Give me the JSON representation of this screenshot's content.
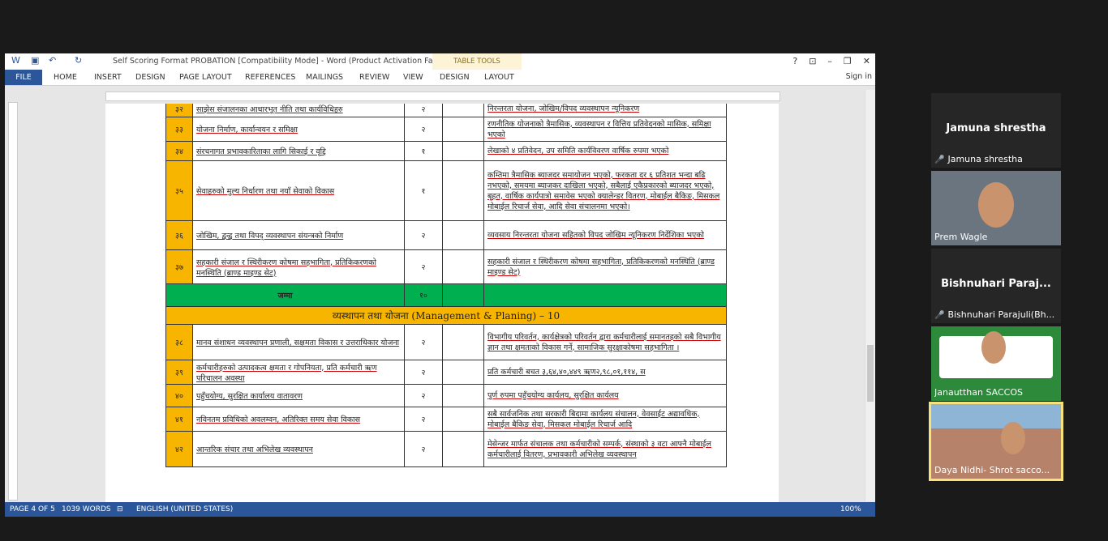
{
  "word": {
    "title": "Self Scoring Format PROBATION [Compatibility Mode] - Word (Product Activation Failed)",
    "table_tools": "TABLE TOOLS",
    "tabs": [
      "FILE",
      "HOME",
      "INSERT",
      "DESIGN",
      "PAGE LAYOUT",
      "REFERENCES",
      "MAILINGS",
      "REVIEW",
      "VIEW",
      "DESIGN",
      "LAYOUT"
    ],
    "sign_in": "Sign in",
    "status": {
      "page": "PAGE 4 OF 5",
      "words": "1039 WORDS",
      "lang": "ENGLISH (UNITED STATES)",
      "zoom": "100%"
    }
  },
  "table": {
    "rows": [
      {
        "num": "३२",
        "name": "साझेस संजालनका आधारभूत नीति तथा कार्यविधिहरु",
        "score": "२",
        "note": "निरन्तरता योजना, जोखिम/विपद व्यवस्थापन न्यूनिकरण"
      },
      {
        "num": "३३",
        "name": "योजना निर्माण, कार्यान्वयन र समिक्षा",
        "score": "२",
        "note": "रणनीतिक योजनाको त्रैमासिक, व्यवस्थापन र वित्तिय प्रतिवेदनको मासिक, समिक्षा भएको"
      },
      {
        "num": "३४",
        "name": "संरचनागत प्रभावकारिताका लागि सिकाई र वृद्दि",
        "score": "१",
        "note": "लेखाको ४ प्रतिवेदन, उप समिति कार्यविवरण वार्षिक रुपमा भएको"
      },
      {
        "num": "३५",
        "name": "सेवाहरुको मुल्य निर्धारण तथा नयाँ सेवाको विकास",
        "score": "१",
        "note": "कम्तिमा त्रैमासिक ब्याजदर समायोजन भएको, फरकता दर ६ प्रतिशत भन्दा बढि नभएको, समयमा ब्याजकर दाखिला भएको, सबैलाई एकैप्रकारको ब्याजदर भएको, बृहत, वार्षिक कार्यपात्रो समावेस भएको क्यालेन्डर वितरण, मोबाईल बैकिङ, मिसकल मोबाईल रिचार्ज सेवा, आदि सेवा संचालनमा भएको।"
      },
      {
        "num": "३६",
        "name": "जोखिम, द्वन्द्व तथा विपद् व्यवस्थापन संयन्त्रको निर्माण",
        "score": "२",
        "note": "व्यवसाय निरन्तरता योजना सहितको विपद जोखिम न्यूनिकरण निर्देशिका भएको"
      },
      {
        "num": "३७",
        "name": "सहकारी संजाल र स्थिरीकरण कोषमा सहभागिता, प्रतिकिकरणको मनस्थिति (ब्राण्ड माइण्ड सेट)",
        "score": "२",
        "note": "सहकारी संजाल र स्थिरीकरण कोषमा सहभागिता, प्रतिकिकरणको मनस्थिति (ब्राण्ड माइण्ड सेट)"
      }
    ],
    "total_label": "जम्मा",
    "total_value": "१०",
    "section_heading": "व्यस्थापन तथा योजना (Management & Planing) – 10",
    "rows2": [
      {
        "num": "३८",
        "name": "मानव संशाधन व्यवस्थापन प्रणाली, सक्षमता विकास र उत्तराधिकार योजना",
        "score": "२",
        "note": "विभागीय परिवर्तन, कार्यक्षेत्रको परिवर्तन द्वारा कर्मचारीलाई समानतहको सबै विभागीय  ज्ञान तथा क्षमताको विकास गर्ने, सामाजिक सुरक्षाकोषमा सहभागिता ।"
      },
      {
        "num": "३९",
        "name": "कर्मचारीहरुको उत्पादकत्व क्षमता र गोपनियता, प्रति कर्मचारी ऋण परिचालन अवस्था",
        "score": "२",
        "note": "प्रति कर्मचारी बचत ३,६४,४०,४४९ ऋण२,९८,०१,११४, स"
      },
      {
        "num": "४०",
        "name": "पहुँचयोग्य, सुरक्षित कार्यालय वातावरण",
        "score": "२",
        "note": "पूर्ण रुपमा पहुँचयोग्य कार्यलय, सुरक्षित कार्यलय"
      },
      {
        "num": "४१",
        "name": "नविनतम प्रविधिको अवलम्वन, अतिरिक्त समय सेवा विकास",
        "score": "२",
        "note": "सबै सार्वजनिक तथा सरकारी बिदामा कार्यलय संचालन, वेवसाईट अद्यावधिक, मोबाईल बैकिङ सेवा, मिसकल मोबाईल रिचार्ज आदि"
      },
      {
        "num": "४२",
        "name": "आन्तरिक संचार तथा अभिलेख व्यवस्थापन",
        "score": "२",
        "note": "मेसेन्जर मार्फत संचालक तथा कर्मचारीको सम्पर्क, संस्थाको ३ वटा आफ्नै मोबाईल कर्मचारीलाई वितरण, प्रभावकारी अभिलेख व्यवस्थापन"
      }
    ]
  },
  "participants": [
    {
      "big": "Jamuna shrestha",
      "label": "Jamuna shrestha",
      "muted": true
    },
    {
      "big": "",
      "label": "Prem Wagle",
      "muted": false
    },
    {
      "big": "Bishnuhari  Paraj...",
      "label": "Bishnuhari Parajuli(Bh...",
      "muted": true
    },
    {
      "big": "",
      "label": "Janautthan SACCOS",
      "muted": false
    },
    {
      "big": "",
      "label": "Daya Nidhi- Shrot sacco...",
      "muted": false
    }
  ],
  "colors": {
    "accent": "#2b579a",
    "table_orange": "#f7b500",
    "table_green": "#00b050",
    "active_speaker": "#f5e27a"
  }
}
